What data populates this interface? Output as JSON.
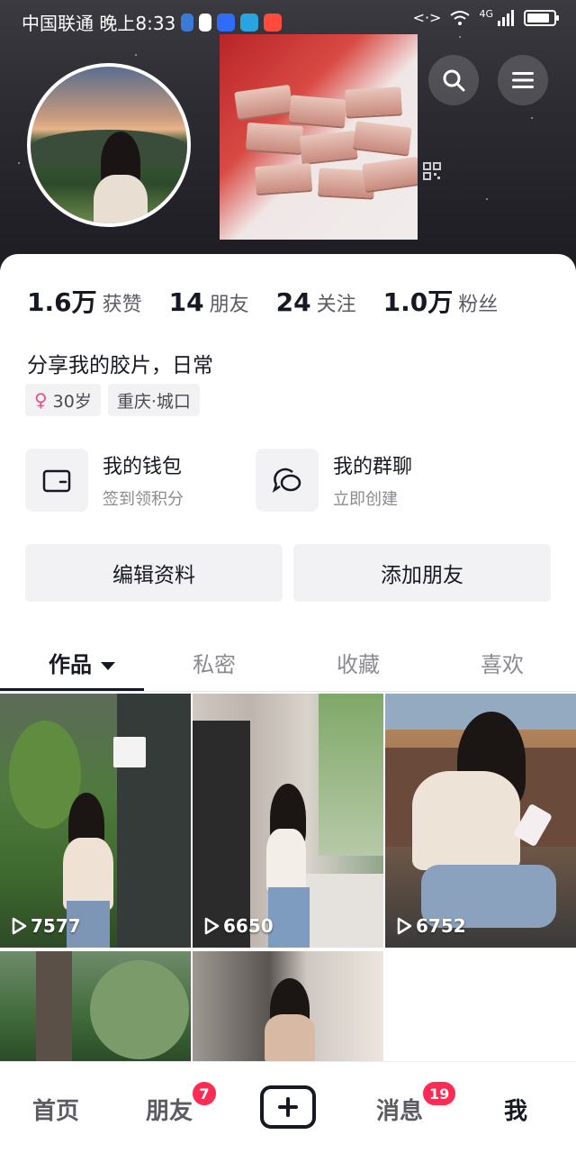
{
  "status_bar": {
    "carrier_time": "中国联通 晚上8:33",
    "network": "4G"
  },
  "profile": {
    "stats": [
      {
        "value": "1.6万",
        "label": "获赞"
      },
      {
        "value": "14",
        "label": "朋友"
      },
      {
        "value": "24",
        "label": "关注"
      },
      {
        "value": "1.0万",
        "label": "粉丝"
      }
    ],
    "bio": "分享我的胶片，日常",
    "tags": {
      "age": "30岁",
      "location": "重庆·城口"
    }
  },
  "shortcuts": [
    {
      "title": "我的钱包",
      "subtitle": "签到领积分",
      "icon": "wallet-icon"
    },
    {
      "title": "我的群聊",
      "subtitle": "立即创建",
      "icon": "group-chat-icon"
    }
  ],
  "actions": {
    "edit_profile": "编辑资料",
    "add_friend": "添加朋友"
  },
  "tabs": [
    "作品",
    "私密",
    "收藏",
    "喜欢"
  ],
  "videos": [
    {
      "plays": "7577"
    },
    {
      "plays": "6650"
    },
    {
      "plays": "6752"
    }
  ],
  "bottom_nav": {
    "home": "首页",
    "friends": "朋友",
    "friends_badge": "7",
    "messages": "消息",
    "messages_badge": "19",
    "me": "我"
  },
  "colors": {
    "accent": "#fe2c55",
    "text": "#161823",
    "gender_female": "#ea4c89"
  }
}
